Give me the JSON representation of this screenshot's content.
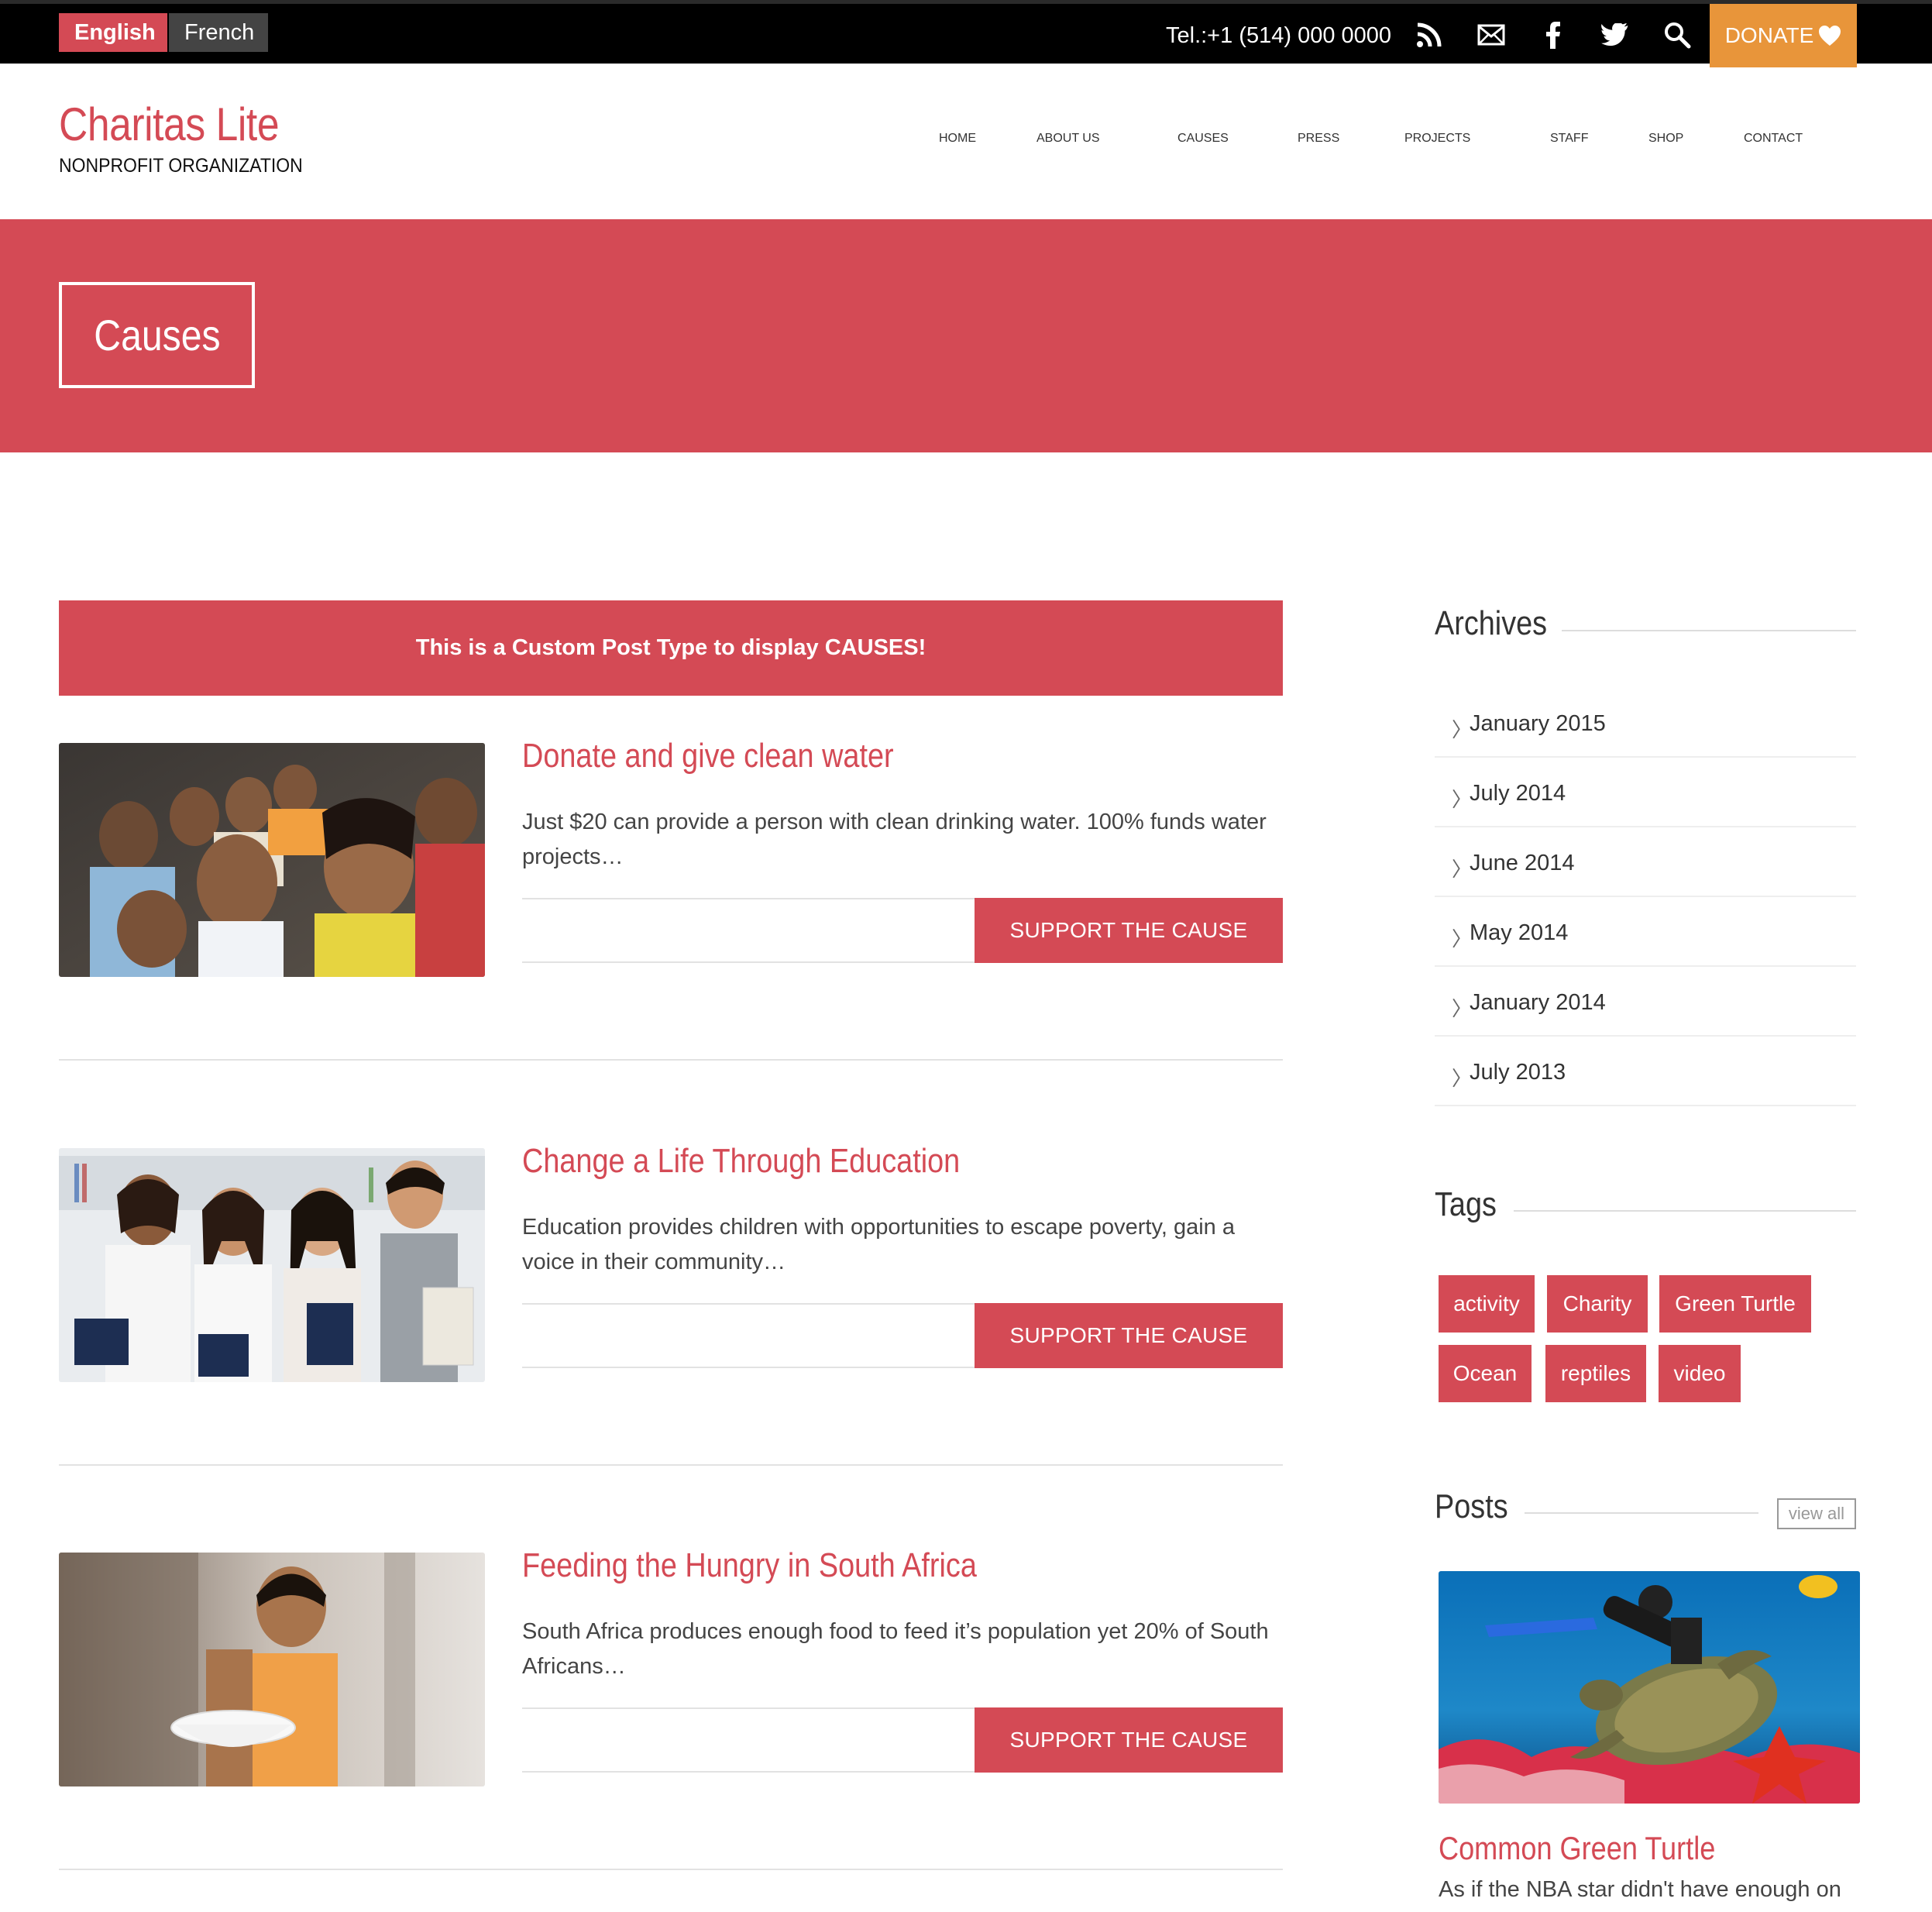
{
  "topbar": {
    "languages": [
      "English",
      "French"
    ],
    "tel": "Tel.:+1 (514) 000 0000",
    "icons": [
      "rss-icon",
      "mail-icon",
      "facebook-icon",
      "twitter-icon",
      "search-icon"
    ],
    "donate": "DONATE"
  },
  "brand": {
    "title": "Charitas Lite",
    "subtitle": "NONPROFIT ORGANIZATION"
  },
  "nav": [
    "HOME",
    "ABOUT US",
    "CAUSES",
    "PRESS",
    "PROJECTS",
    "STAFF",
    "SHOP",
    "CONTACT"
  ],
  "nav_active": "CAUSES",
  "hero": {
    "title": "Causes"
  },
  "notice": "This is a Custom Post Type to display CAUSES!",
  "causes": [
    {
      "title": "Donate and give clean water",
      "excerpt": "Just $20 can provide a person with clean drinking water. 100% funds water projects…",
      "button": "SUPPORT THE CAUSE"
    },
    {
      "title": "Change a Life Through Education",
      "excerpt": "Education provides children with opportunities to escape poverty, gain a voice in their community…",
      "button": "SUPPORT THE CAUSE"
    },
    {
      "title": "Feeding the Hungry in South Africa",
      "excerpt": "South Africa produces enough food to feed it’s population yet 20% of South Africans…",
      "button": "SUPPORT THE CAUSE"
    }
  ],
  "sidebar": {
    "archives_title": "Archives",
    "archives": [
      "January 2015",
      "July 2014",
      "June 2014",
      "May 2014",
      "January 2014",
      "July 2013"
    ],
    "tags_title": "Tags",
    "tags": [
      "activity",
      "Charity",
      "Green Turtle",
      "Ocean",
      "reptiles",
      "video"
    ],
    "posts_title": "Posts",
    "view_all": "view all",
    "post": {
      "title": "Common Green Turtle",
      "excerpt": "As if the NBA star didn't have enough on"
    }
  },
  "colors": {
    "accent": "#d44a55",
    "donate": "#e8953a",
    "topbar": "#000000"
  }
}
